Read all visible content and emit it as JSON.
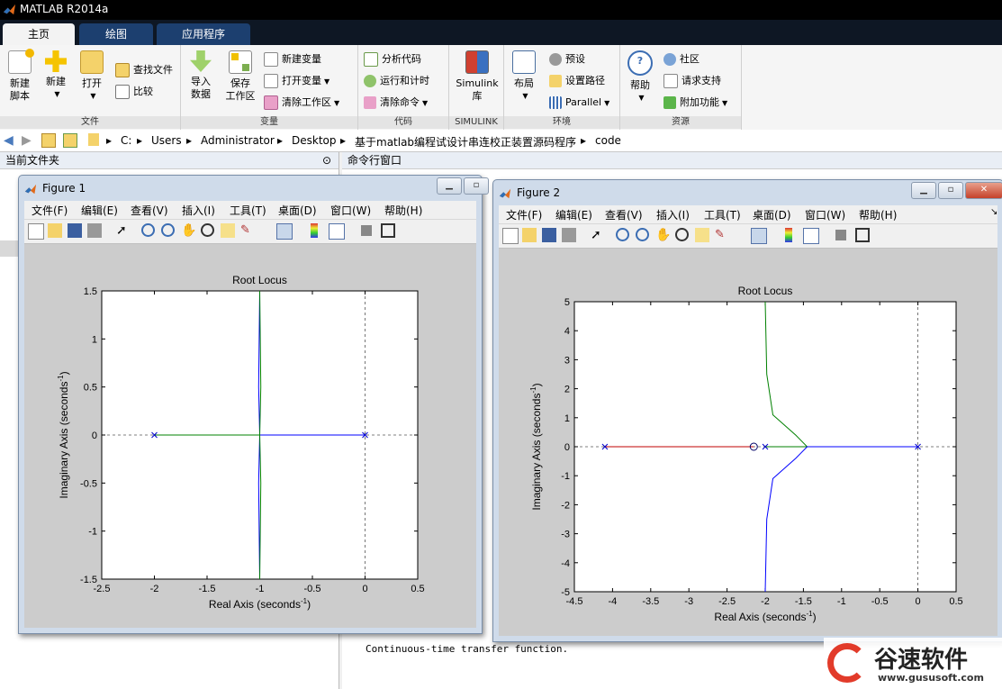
{
  "window": {
    "title": "MATLAB R2014a"
  },
  "tabs": [
    {
      "label": "主页",
      "active": true
    },
    {
      "label": "绘图",
      "active": false
    },
    {
      "label": "应用程序",
      "active": false
    }
  ],
  "ribbon": {
    "file": {
      "label": "文件",
      "new_script": "新建\n脚本",
      "new_script_l1": "新建",
      "new_script_l2": "脚本",
      "new": "新建",
      "open": "打开",
      "find_files": "查找文件",
      "compare": "比较"
    },
    "variable": {
      "label": "变量",
      "import": "导入",
      "import_l2": "数据",
      "save": "保存",
      "save_l2": "工作区",
      "new_var": "新建变量",
      "open_var": "打开变量",
      "clear_ws": "清除工作区"
    },
    "code": {
      "label": "代码",
      "analyze": "分析代码",
      "run_time": "运行和计时",
      "clear_cmd": "清除命令"
    },
    "simulink": {
      "label": "SIMULINK",
      "lib_l1": "Simulink",
      "lib_l2": "库"
    },
    "env": {
      "label": "环境",
      "layout": "布局",
      "prefs": "预设",
      "set_path": "设置路径",
      "parallel": "Parallel"
    },
    "res": {
      "label": "资源",
      "help": "帮助",
      "community": "社区",
      "request": "请求支持",
      "addons": "附加功能"
    }
  },
  "address": {
    "crumbs": [
      "C:",
      "Users",
      "Administrator",
      "Desktop",
      "基于matlab编程试设计串连校正装置源码程序",
      "code"
    ]
  },
  "panels": {
    "current_folder": "当前文件夹",
    "command_window": "命令行窗口",
    "cmd_output": "Continuous-time transfer function."
  },
  "figures": [
    {
      "title": "Figure 1",
      "menus": [
        "文件(F)",
        "编辑(E)",
        "查看(V)",
        "插入(I)",
        "工具(T)",
        "桌面(D)",
        "窗口(W)",
        "帮助(H)"
      ],
      "plot_title": "Root Locus",
      "xlabel": "Real Axis (seconds",
      "ylabel": "Imaginary Axis (seconds",
      "label_exp": "-1",
      "xticks": [
        "-2.5",
        "-2",
        "-1.5",
        "-1",
        "-0.5",
        "0",
        "0.5"
      ],
      "yticks": [
        "1.5",
        "1",
        "0.5",
        "0",
        "-0.5",
        "-1",
        "-1.5"
      ]
    },
    {
      "title": "Figure 2",
      "menus": [
        "文件(F)",
        "编辑(E)",
        "查看(V)",
        "插入(I)",
        "工具(T)",
        "桌面(D)",
        "窗口(W)",
        "帮助(H)"
      ],
      "plot_title": "Root Locus",
      "xlabel": "Real Axis (seconds",
      "ylabel": "Imaginary Axis (seconds",
      "label_exp": "-1",
      "xticks": [
        "-4.5",
        "-4",
        "-3.5",
        "-3",
        "-2.5",
        "-2",
        "-1.5",
        "-1",
        "-0.5",
        "0",
        "0.5"
      ],
      "yticks": [
        "5",
        "4",
        "3",
        "2",
        "1",
        "0",
        "-1",
        "-2",
        "-3",
        "-4",
        "-5"
      ]
    }
  ],
  "chart_data": [
    {
      "type": "line",
      "title": "Root Locus",
      "xlim": [
        -2.5,
        0.5
      ],
      "ylim": [
        -1.5,
        1.5
      ],
      "poles": [
        [
          -2,
          0
        ],
        [
          0,
          0
        ]
      ],
      "series": [
        {
          "color": "#0000ff",
          "points": [
            [
              0,
              0
            ],
            [
              -1,
              0
            ],
            [
              -1.01,
              0.5
            ],
            [
              -1,
              1.5
            ]
          ]
        },
        {
          "color": "#0000ff",
          "points": [
            [
              0,
              0
            ],
            [
              -1,
              0
            ],
            [
              -1.01,
              -0.5
            ],
            [
              -1,
              -1.5
            ]
          ]
        },
        {
          "color": "#008000",
          "points": [
            [
              -2,
              0
            ],
            [
              -1,
              0
            ],
            [
              -0.99,
              0.5
            ],
            [
              -1,
              1.5
            ]
          ]
        },
        {
          "color": "#008000",
          "points": [
            [
              -2,
              0
            ],
            [
              -1,
              0
            ],
            [
              -0.99,
              -0.5
            ],
            [
              -1,
              -1.5
            ]
          ]
        }
      ]
    },
    {
      "type": "line",
      "title": "Root Locus",
      "xlim": [
        -4.5,
        0.5
      ],
      "ylim": [
        -5,
        5
      ],
      "poles": [
        [
          -4.1,
          0
        ],
        [
          -2,
          0
        ],
        [
          0,
          0
        ]
      ],
      "zeros": [
        [
          -2.15,
          0
        ]
      ],
      "series": [
        {
          "color": "#c00000",
          "points": [
            [
              -4.1,
              0
            ],
            [
              -2.15,
              0
            ]
          ]
        },
        {
          "color": "#008000",
          "points": [
            [
              -2,
              0
            ],
            [
              -1.45,
              0
            ],
            [
              -1.6,
              0.4
            ],
            [
              -1.9,
              1.1
            ],
            [
              -1.98,
              2.5
            ],
            [
              -2,
              5
            ]
          ]
        },
        {
          "color": "#0000ff",
          "points": [
            [
              0,
              0
            ],
            [
              -1.45,
              0
            ],
            [
              -1.6,
              -0.4
            ],
            [
              -1.9,
              -1.1
            ],
            [
              -1.98,
              -2.5
            ],
            [
              -2,
              -5
            ]
          ]
        }
      ]
    }
  ],
  "watermark": {
    "text": "谷速软件",
    "url": "www.gususoft.com"
  }
}
